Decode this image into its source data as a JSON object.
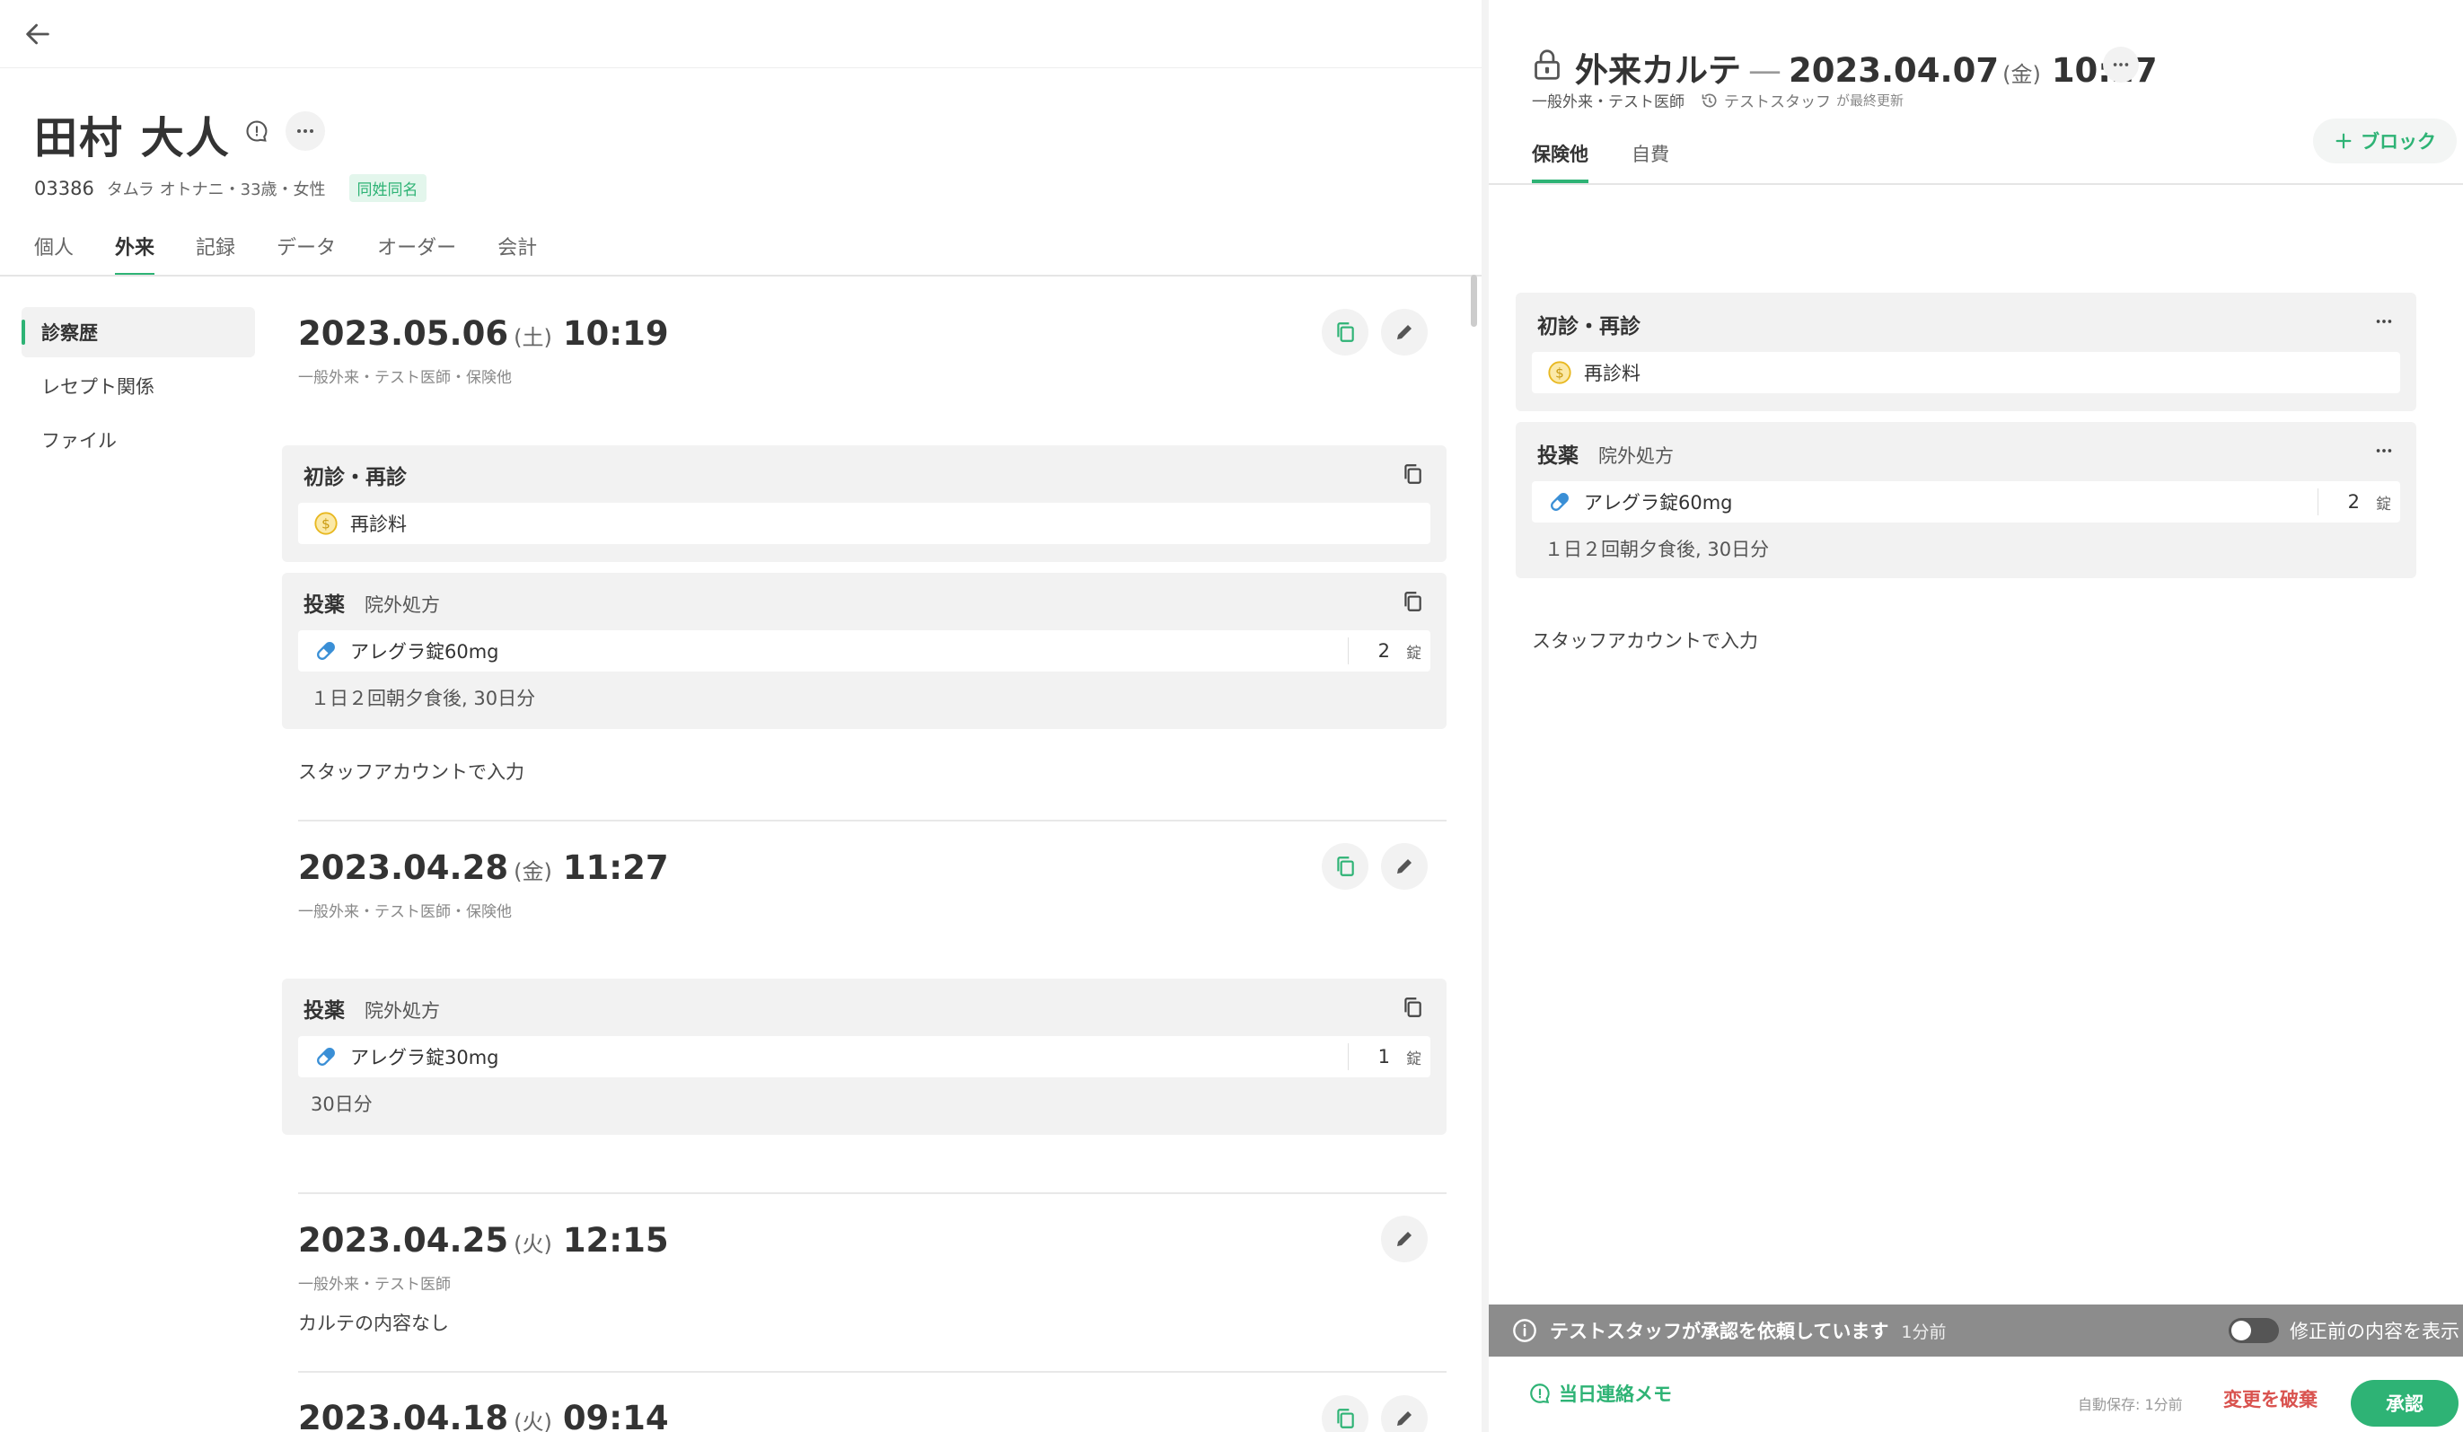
{
  "patient": {
    "name": "田村 大人",
    "id": "03386",
    "kana_age_sex": "タムラ オトナニ・33歳・女性",
    "same_name_badge": "同姓同名"
  },
  "main_tabs": [
    "個人",
    "外来",
    "記録",
    "データ",
    "オーダー",
    "会計"
  ],
  "active_main_tab": "外来",
  "sidenav": [
    "診察歴",
    "レセプト関係",
    "ファイル"
  ],
  "records": [
    {
      "date": "2023.05.06",
      "dow": "(土)",
      "time": "10:19",
      "sub": "一般外来・テスト医師・保険他",
      "blocks": {
        "visit": {
          "title": "初診・再診",
          "item": "再診料"
        },
        "med": {
          "title": "投薬",
          "subtitle": "院外処方",
          "item": "アレグラ錠60mg",
          "qty": "2",
          "unit": "錠",
          "note": "１日２回朝夕食後, 30日分"
        }
      },
      "free_text": "スタッフアカウントで入力"
    },
    {
      "date": "2023.04.28",
      "dow": "(金)",
      "time": "11:27",
      "sub": "一般外来・テスト医師・保険他",
      "blocks": {
        "med": {
          "title": "投薬",
          "subtitle": "院外処方",
          "item": "アレグラ錠30mg",
          "qty": "1",
          "unit": "錠",
          "note": "30日分"
        }
      }
    },
    {
      "date": "2023.04.25",
      "dow": "(火)",
      "time": "12:15",
      "sub": "一般外来・テスト医師",
      "free_text": "カルテの内容なし"
    },
    {
      "date": "2023.04.18",
      "dow": "(火)",
      "time": "09:14"
    }
  ],
  "karte": {
    "title": "外来カルテ",
    "dash": "—",
    "date": "2023.04.07",
    "dow": "(金)",
    "time": "10:27",
    "sub": "一般外来・テスト医師",
    "updated_by": "テストスタッフ",
    "updated_suffix": "が最終更新",
    "add_block": "ブロック",
    "tabs": [
      "保険他",
      "自費"
    ],
    "active_tab": "保険他",
    "visit_block": {
      "title": "初診・再診",
      "item": "再診料"
    },
    "med_block": {
      "title": "投薬",
      "subtitle": "院外処方",
      "item": "アレグラ錠60mg",
      "qty": "2",
      "unit": "錠",
      "note": "１日２回朝夕食後, 30日分"
    },
    "free_text": "スタッフアカウントで入力"
  },
  "approval": {
    "message": "テストスタッフが承認を依頼しています",
    "ago": "1分前",
    "toggle_label": "修正前の内容を表示"
  },
  "footer": {
    "memo": "当日連絡メモ",
    "autosave": "自動保存: 1分前",
    "discard": "変更を破棄",
    "approve": "承認"
  },
  "icons": {
    "back": "arrow-left-icon",
    "info": "speech-bubble-icon",
    "more": "ellipsis-icon",
    "copy": "copy-icon",
    "edit": "pencil-icon",
    "coin": "coin-icon",
    "pill": "pill-icon",
    "lock": "lock-icon",
    "history": "history-icon",
    "plus": "plus-icon",
    "memo": "memo-icon"
  },
  "colors": {
    "accent": "#2eb375",
    "danger": "#d9534f",
    "coin": "#e8b820",
    "pill": "#3a8fd6",
    "approval_bar": "#8c8c8c"
  }
}
